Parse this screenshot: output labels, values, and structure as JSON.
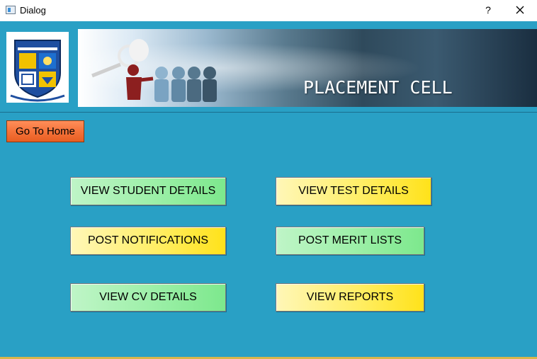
{
  "window": {
    "title": "Dialog",
    "help_glyph": "?",
    "close_icon": "close-icon"
  },
  "header": {
    "banner_title": "PLACEMENT CELL",
    "logo_icon": "college-crest-icon"
  },
  "nav": {
    "home_label": "Go To Home"
  },
  "actions": {
    "view_student_details": "VIEW STUDENT DETAILS",
    "view_test_details": "VIEW TEST DETAILS",
    "post_notifications": "POST NOTIFICATIONS",
    "post_merit_lists": "POST MERIT LISTS",
    "view_cv_details": "VIEW CV DETAILS",
    "view_reports": "VIEW REPORTS"
  },
  "colors": {
    "background": "#29a0c5",
    "home_button": "#f5733a",
    "green_button": "#9ff0aa",
    "yellow_button": "#ffee66"
  }
}
